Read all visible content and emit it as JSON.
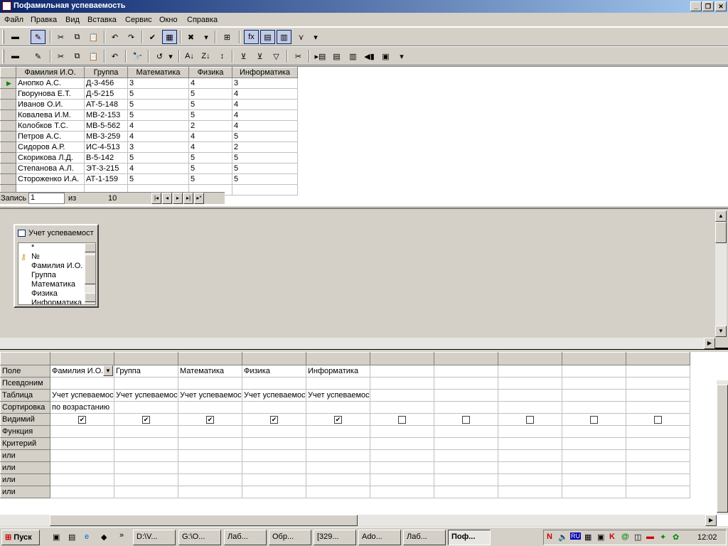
{
  "window": {
    "title": "Пофамильная успеваемость"
  },
  "menu": [
    "Файл",
    "Правка",
    "Вид",
    "Вставка",
    "Сервис",
    "Окно",
    "Справка"
  ],
  "datasheet": {
    "columns": [
      "Фамилия И.О.",
      "Группа",
      "Математика",
      "Физика",
      "Информатика"
    ],
    "rows": [
      [
        "Анопко А.С.",
        "Д-3-456",
        "3",
        "4",
        "3"
      ],
      [
        "Гворунова Е.Т.",
        "Д-5-215",
        "5",
        "5",
        "4"
      ],
      [
        "Иванов О.И.",
        "АТ-5-148",
        "5",
        "5",
        "4"
      ],
      [
        "Ковалева И.М.",
        "МВ-2-153",
        "5",
        "5",
        "4"
      ],
      [
        "Колобков Т.С.",
        "МВ-5-562",
        "4",
        "2",
        "4"
      ],
      [
        "Петров А.С.",
        "МВ-3-259",
        "4",
        "4",
        "5"
      ],
      [
        "Сидоров А.Р.",
        "ИС-4-513",
        "3",
        "4",
        "2"
      ],
      [
        "Скорикова Л.Д.",
        "В-5-142",
        "5",
        "5",
        "5"
      ],
      [
        "Степанова А.Л.",
        "ЭТ-3-215",
        "4",
        "5",
        "5"
      ],
      [
        "Стороженко И.А.",
        "АТ-1-159",
        "5",
        "5",
        "5"
      ]
    ]
  },
  "navigation": {
    "record_label": "Запись",
    "record_value": "1",
    "of_label": "из",
    "total": "10"
  },
  "field_list": {
    "title": "Учет успеваемост",
    "items": [
      "*",
      "№",
      "Фамилия И.О.",
      "Группа",
      "Математика",
      "Физика",
      "Информатика"
    ]
  },
  "query_grid": {
    "row_labels": [
      "Поле",
      "Псевдоним",
      "Таблица",
      "Сортировка",
      "Видимий",
      "Функция",
      "Критерий",
      "или",
      "или",
      "или",
      "или"
    ],
    "fields": [
      "Фамилия И.О.",
      "Группа",
      "Математика",
      "Физика",
      "Информатика"
    ],
    "table": "Учет успеваемос",
    "sort": "по возрастанию",
    "visible": [
      true,
      true,
      true,
      true,
      true,
      false,
      false,
      false,
      false,
      false
    ]
  },
  "taskbar": {
    "start": "Пуск",
    "tasks": [
      "D:\\V...",
      "G:\\О...",
      "Лаб...",
      "Обр...",
      "[329...",
      "Ado...",
      "Лаб...",
      "Поф..."
    ],
    "clock": "12:02",
    "lang": "RU"
  }
}
